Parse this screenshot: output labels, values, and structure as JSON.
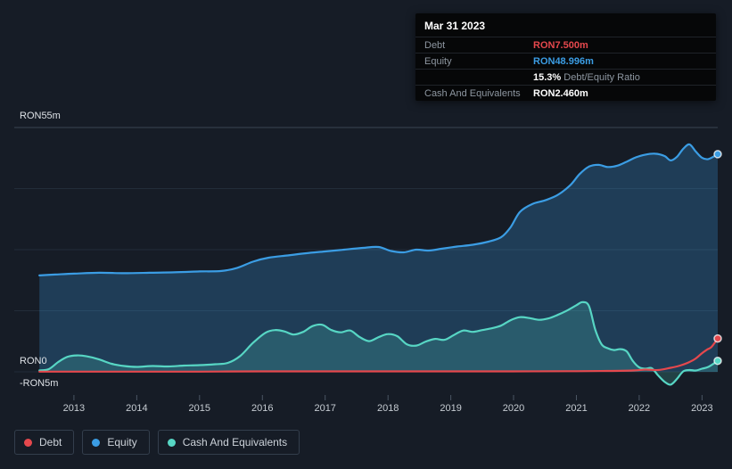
{
  "colors": {
    "background": "#161c26",
    "debt": "#e5484d",
    "equity": "#3b9de4",
    "cash": "#57d6c4",
    "grid": "#232d39",
    "grid_top": "#3a4552",
    "tick_text": "#c6ccd2",
    "white": "#ffffff"
  },
  "tooltip": {
    "date": "Mar 31 2023",
    "debt_label": "Debt",
    "debt_value": "RON7.500m",
    "equity_label": "Equity",
    "equity_value": "RON48.996m",
    "ratio_value": "15.3%",
    "ratio_label": " Debt/Equity Ratio",
    "cash_label": "Cash And Equivalents",
    "cash_value": "RON2.460m"
  },
  "axis": {
    "y_max_label": "RON55m",
    "y_zero_label": "RON0",
    "y_min_label": "-RON5m"
  },
  "legend": [
    {
      "label": "Debt",
      "color": "#e5484d"
    },
    {
      "label": "Equity",
      "color": "#3b9de4"
    },
    {
      "label": "Cash And Equivalents",
      "color": "#57d6c4"
    }
  ],
  "chart_data": {
    "type": "area",
    "x_domain": [
      2012.05,
      2023.25
    ],
    "y_max": 55,
    "y_min": -5,
    "x_ticks": [
      2013,
      2014,
      2015,
      2016,
      2017,
      2018,
      2019,
      2020,
      2021,
      2022,
      2023
    ],
    "gridline_values": [
      55,
      41.25,
      27.5,
      13.75,
      0
    ],
    "y_unit": "RON millions",
    "latest": {
      "date": "Mar 31 2023",
      "debt": 7.5,
      "equity": 48.996,
      "cash": 2.46,
      "debt_to_equity_pct": 15.3
    },
    "series": [
      {
        "name": "Equity",
        "color": "#3b9de4",
        "fill": "rgba(59,157,228,0.26)",
        "points": [
          [
            2012.45,
            21.7
          ],
          [
            2012.7,
            21.9
          ],
          [
            2013.0,
            22.1
          ],
          [
            2013.4,
            22.3
          ],
          [
            2013.8,
            22.2
          ],
          [
            2014.2,
            22.3
          ],
          [
            2014.6,
            22.4
          ],
          [
            2015.0,
            22.6
          ],
          [
            2015.35,
            22.7
          ],
          [
            2015.6,
            23.4
          ],
          [
            2015.85,
            24.8
          ],
          [
            2016.1,
            25.7
          ],
          [
            2016.4,
            26.2
          ],
          [
            2016.7,
            26.7
          ],
          [
            2017.0,
            27.1
          ],
          [
            2017.3,
            27.5
          ],
          [
            2017.6,
            27.9
          ],
          [
            2017.85,
            28.1
          ],
          [
            2018.05,
            27.2
          ],
          [
            2018.25,
            26.9
          ],
          [
            2018.45,
            27.5
          ],
          [
            2018.65,
            27.3
          ],
          [
            2018.85,
            27.7
          ],
          [
            2019.1,
            28.2
          ],
          [
            2019.35,
            28.6
          ],
          [
            2019.6,
            29.3
          ],
          [
            2019.8,
            30.3
          ],
          [
            2019.95,
            32.5
          ],
          [
            2020.1,
            36.0
          ],
          [
            2020.3,
            37.8
          ],
          [
            2020.5,
            38.6
          ],
          [
            2020.7,
            39.8
          ],
          [
            2020.9,
            42.0
          ],
          [
            2021.05,
            44.5
          ],
          [
            2021.2,
            46.2
          ],
          [
            2021.35,
            46.6
          ],
          [
            2021.5,
            46.1
          ],
          [
            2021.65,
            46.4
          ],
          [
            2021.8,
            47.3
          ],
          [
            2021.95,
            48.3
          ],
          [
            2022.1,
            48.9
          ],
          [
            2022.25,
            49.1
          ],
          [
            2022.4,
            48.6
          ],
          [
            2022.5,
            47.6
          ],
          [
            2022.6,
            48.4
          ],
          [
            2022.7,
            50.2
          ],
          [
            2022.8,
            51.2
          ],
          [
            2022.9,
            49.6
          ],
          [
            2023.0,
            48.2
          ],
          [
            2023.1,
            47.9
          ],
          [
            2023.25,
            48.996
          ]
        ]
      },
      {
        "name": "Cash And Equivalents",
        "color": "#57d6c4",
        "fill": "rgba(87,214,196,0.20)",
        "points": [
          [
            2012.45,
            0.3
          ],
          [
            2012.6,
            0.6
          ],
          [
            2012.75,
            2.2
          ],
          [
            2012.9,
            3.4
          ],
          [
            2013.05,
            3.7
          ],
          [
            2013.2,
            3.5
          ],
          [
            2013.4,
            2.8
          ],
          [
            2013.6,
            1.8
          ],
          [
            2013.8,
            1.3
          ],
          [
            2014.0,
            1.1
          ],
          [
            2014.25,
            1.3
          ],
          [
            2014.5,
            1.2
          ],
          [
            2014.75,
            1.4
          ],
          [
            2015.0,
            1.5
          ],
          [
            2015.25,
            1.7
          ],
          [
            2015.45,
            2.0
          ],
          [
            2015.65,
            3.6
          ],
          [
            2015.85,
            6.5
          ],
          [
            2016.05,
            8.8
          ],
          [
            2016.2,
            9.4
          ],
          [
            2016.35,
            9.1
          ],
          [
            2016.5,
            8.4
          ],
          [
            2016.65,
            9.0
          ],
          [
            2016.8,
            10.3
          ],
          [
            2016.95,
            10.6
          ],
          [
            2017.1,
            9.4
          ],
          [
            2017.25,
            8.9
          ],
          [
            2017.4,
            9.3
          ],
          [
            2017.55,
            7.8
          ],
          [
            2017.7,
            6.9
          ],
          [
            2017.85,
            7.8
          ],
          [
            2018.0,
            8.5
          ],
          [
            2018.15,
            8.0
          ],
          [
            2018.3,
            6.2
          ],
          [
            2018.45,
            5.9
          ],
          [
            2018.6,
            6.8
          ],
          [
            2018.75,
            7.4
          ],
          [
            2018.9,
            7.2
          ],
          [
            2019.05,
            8.3
          ],
          [
            2019.2,
            9.3
          ],
          [
            2019.35,
            9.0
          ],
          [
            2019.5,
            9.4
          ],
          [
            2019.65,
            9.8
          ],
          [
            2019.8,
            10.4
          ],
          [
            2019.95,
            11.6
          ],
          [
            2020.1,
            12.3
          ],
          [
            2020.25,
            12.1
          ],
          [
            2020.4,
            11.7
          ],
          [
            2020.55,
            12.0
          ],
          [
            2020.7,
            12.8
          ],
          [
            2020.85,
            13.8
          ],
          [
            2021.0,
            15.0
          ],
          [
            2021.1,
            15.7
          ],
          [
            2021.2,
            14.8
          ],
          [
            2021.3,
            9.5
          ],
          [
            2021.4,
            6.2
          ],
          [
            2021.5,
            5.3
          ],
          [
            2021.6,
            4.9
          ],
          [
            2021.7,
            5.1
          ],
          [
            2021.8,
            4.6
          ],
          [
            2021.9,
            2.4
          ],
          [
            2022.0,
            1.0
          ],
          [
            2022.1,
            0.7
          ],
          [
            2022.2,
            0.8
          ],
          [
            2022.3,
            -0.8
          ],
          [
            2022.4,
            -2.2
          ],
          [
            2022.5,
            -2.9
          ],
          [
            2022.6,
            -1.6
          ],
          [
            2022.7,
            0.1
          ],
          [
            2022.8,
            0.4
          ],
          [
            2022.9,
            0.3
          ],
          [
            2023.0,
            0.7
          ],
          [
            2023.1,
            1.1
          ],
          [
            2023.25,
            2.46
          ]
        ]
      },
      {
        "name": "Debt",
        "color": "#e5484d",
        "fill": null,
        "points": [
          [
            2012.45,
            0.05
          ],
          [
            2013.0,
            0.05
          ],
          [
            2014.0,
            0.05
          ],
          [
            2015.0,
            0.05
          ],
          [
            2016.0,
            0.1
          ],
          [
            2017.0,
            0.1
          ],
          [
            2018.0,
            0.1
          ],
          [
            2019.0,
            0.1
          ],
          [
            2020.0,
            0.1
          ],
          [
            2021.0,
            0.15
          ],
          [
            2021.5,
            0.2
          ],
          [
            2021.9,
            0.3
          ],
          [
            2022.1,
            0.5
          ],
          [
            2022.3,
            0.4
          ],
          [
            2022.5,
            0.9
          ],
          [
            2022.65,
            1.4
          ],
          [
            2022.8,
            2.2
          ],
          [
            2022.9,
            3.0
          ],
          [
            2023.0,
            4.2
          ],
          [
            2023.08,
            5.0
          ],
          [
            2023.15,
            5.6
          ],
          [
            2023.25,
            7.5
          ]
        ]
      }
    ]
  }
}
